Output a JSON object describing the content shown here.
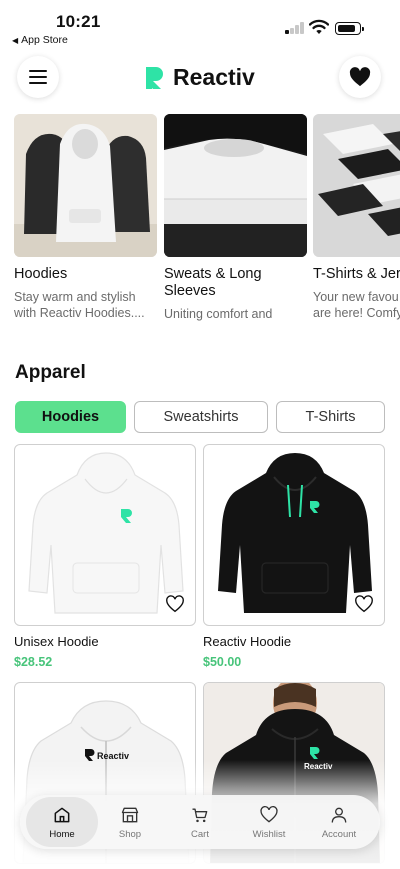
{
  "status_bar": {
    "time": "10:21",
    "back_label": "App Store",
    "icons": [
      "cellular-signal-icon",
      "wifi-icon",
      "battery-icon"
    ]
  },
  "header": {
    "brand": "Reactiv",
    "left_icon": "menu-icon",
    "right_icon": "heart-icon",
    "brand_color": "#2ee3a6"
  },
  "categories": [
    {
      "title": "Hoodies",
      "description": "Stay warm and stylish\nwith Reactiv Hoodies...."
    },
    {
      "title": "Sweats & Long\nSleeves",
      "description": "Uniting comfort and\nstyle with premium mat..."
    },
    {
      "title": "T-Shirts & Jer",
      "description": "Your new favou\nare here! Comfy"
    }
  ],
  "apparel": {
    "title": "Apparel",
    "filters": [
      {
        "label": "Hoodies",
        "active": true
      },
      {
        "label": "Sweatshirts",
        "active": false
      },
      {
        "label": "T-Shirts",
        "active": false
      }
    ],
    "products": [
      {
        "name": "Unisex Hoodie",
        "price": "$28.52"
      },
      {
        "name": "Reactiv Hoodie",
        "price": "$50.00"
      },
      {
        "name": "",
        "price": "",
        "print": "Reactiv"
      },
      {
        "name": "",
        "price": "",
        "print": "Reactiv"
      }
    ]
  },
  "tab_bar": {
    "tabs": [
      {
        "label": "Home",
        "icon": "home-icon",
        "active": true
      },
      {
        "label": "Shop",
        "icon": "shop-icon",
        "active": false
      },
      {
        "label": "Cart",
        "icon": "cart-icon",
        "active": false
      },
      {
        "label": "Wishlist",
        "icon": "heart-icon",
        "active": false
      },
      {
        "label": "Account",
        "icon": "account-icon",
        "active": false
      }
    ]
  },
  "colors": {
    "accent": "#5ce08e",
    "price": "#47c47a",
    "logo": "#2ee3a6"
  }
}
